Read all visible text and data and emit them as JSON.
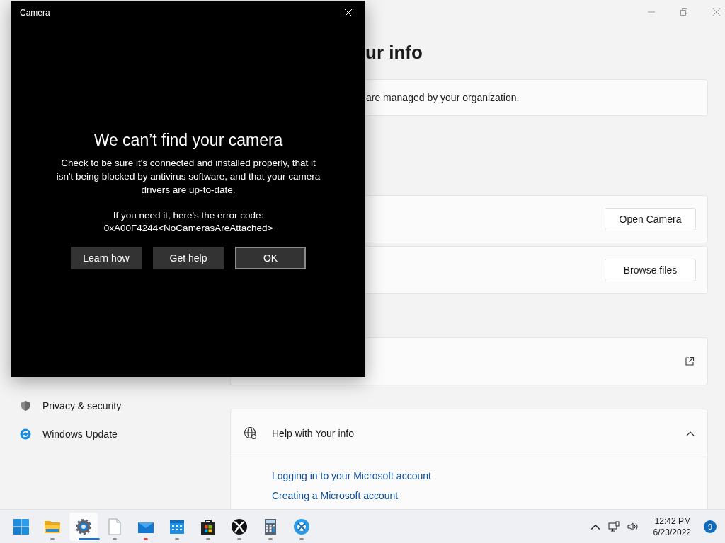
{
  "settings": {
    "heading": "ur info",
    "notice": "are managed by your organization.",
    "nav": [
      {
        "label": "Privacy & security",
        "kind": "shield"
      },
      {
        "label": "Windows Update",
        "kind": "update"
      }
    ],
    "actions": [
      {
        "button": "Open Camera"
      },
      {
        "button": "Browse files"
      }
    ],
    "help": {
      "title": "Help with Your info",
      "expanded": true,
      "links": [
        "Logging in to your Microsoft account",
        "Creating a Microsoft account"
      ]
    }
  },
  "dialog": {
    "title": "Camera",
    "heading": "We can’t find your camera",
    "message": "Check to be sure it's connected and installed properly, that it isn't being blocked by antivirus software, and that your camera drivers are up-to-date.",
    "error_label": "If you need it, here's the error code:",
    "error_code": "0xA00F4244<NoCamerasAreAttached>",
    "buttons": [
      {
        "label": "Learn how",
        "focused": false
      },
      {
        "label": "Get help",
        "focused": false
      },
      {
        "label": "OK",
        "focused": true
      }
    ]
  },
  "taskbar": {
    "apps": [
      {
        "kind": "start",
        "open": false,
        "selected": false,
        "attention": false
      },
      {
        "kind": "folder",
        "open": true,
        "selected": false,
        "attention": false
      },
      {
        "kind": "gear",
        "open": true,
        "selected": true,
        "attention": false
      },
      {
        "kind": "document",
        "open": true,
        "selected": false,
        "attention": false
      },
      {
        "kind": "mail",
        "open": true,
        "selected": false,
        "attention": true
      },
      {
        "kind": "calendar",
        "open": true,
        "selected": false,
        "attention": false
      },
      {
        "kind": "bag",
        "open": true,
        "selected": false,
        "attention": false
      },
      {
        "kind": "xbox",
        "open": true,
        "selected": false,
        "attention": false
      },
      {
        "kind": "calculator",
        "open": true,
        "selected": false,
        "attention": false
      },
      {
        "kind": "snip",
        "open": true,
        "selected": false,
        "attention": false
      }
    ],
    "time": "12:42 PM",
    "date": "6/23/2022",
    "notifications": "9"
  }
}
